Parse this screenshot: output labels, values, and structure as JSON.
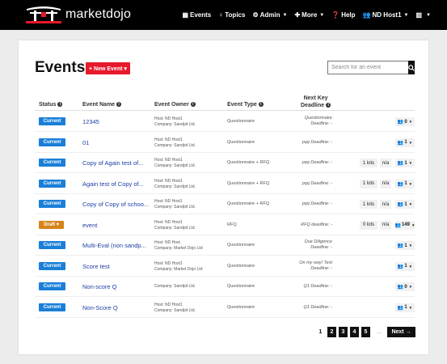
{
  "brand": {
    "name": "marketdojo"
  },
  "nav": [
    {
      "key": "events",
      "label": "Events",
      "icon": "calendar-icon",
      "glyph": "▦",
      "caret": false
    },
    {
      "key": "topics",
      "label": "Topics",
      "icon": "lightbulb-icon",
      "glyph": "♀",
      "caret": false
    },
    {
      "key": "admin",
      "label": "Admin",
      "icon": "cogs-icon",
      "glyph": "⚙",
      "caret": true
    },
    {
      "key": "more",
      "label": "More",
      "icon": "plus-icon",
      "glyph": "✚",
      "caret": true
    },
    {
      "key": "help",
      "label": "Help",
      "icon": "question-icon",
      "glyph": "❓",
      "caret": false
    },
    {
      "key": "user",
      "label": "ND Host1",
      "icon": "users-icon",
      "glyph": "👥",
      "caret": true
    },
    {
      "key": "lang",
      "label": "",
      "icon": "uk-flag-icon",
      "glyph": "▥",
      "caret": true
    }
  ],
  "page": {
    "title": "Events",
    "new_event_label": "+ New Event ▾",
    "search_placeholder": "Search for an event"
  },
  "columns": {
    "status": "Status",
    "name": "Event Name",
    "owner": "Event Owner",
    "type": "Event Type",
    "deadline_line1": "Next Key",
    "deadline_line2": "Deadline"
  },
  "rows": [
    {
      "status": "Current",
      "status_kind": "current",
      "name": "12345",
      "owner": [
        "Host: ND Host1",
        "Company: Sandpit Ltd."
      ],
      "type": "Questionnaire",
      "deadline": [
        "Questionnaire",
        "Deadline: -"
      ],
      "lots": "",
      "na": "",
      "users": "0"
    },
    {
      "status": "Current",
      "status_kind": "current",
      "name": "01",
      "owner": [
        "Host: ND Host1",
        "Company: Sandpit Ltd."
      ],
      "type": "Questionnaire",
      "deadline": [
        "pqq Deadline: -"
      ],
      "lots": "",
      "na": "",
      "users": "1"
    },
    {
      "status": "Current",
      "status_kind": "current",
      "name": "Copy of Again test of...",
      "owner": [
        "Host: ND Host1",
        "Company: Sandpit Ltd."
      ],
      "type": "Questionnaire + RFQ",
      "deadline": [
        "pqq Deadline: -"
      ],
      "lots": "1 lots",
      "na": "n/a",
      "users": "1"
    },
    {
      "status": "Current",
      "status_kind": "current",
      "name": "Again test of Copy of...",
      "owner": [
        "Host: ND Host1",
        "Company: Sandpit Ltd."
      ],
      "type": "Questionnaire + RFQ",
      "deadline": [
        "pqq Deadline: -"
      ],
      "lots": "1 lots",
      "na": "n/a",
      "users": "1"
    },
    {
      "status": "Current",
      "status_kind": "current",
      "name": "Copy of Copy of schoo...",
      "owner": [
        "Host: ND Host1",
        "Company: Sandpit Ltd."
      ],
      "type": "Questionnaire + RFQ",
      "deadline": [
        "pqq Deadline: -"
      ],
      "lots": "1 lots",
      "na": "n/a",
      "users": "1"
    },
    {
      "status": "Draft ▾",
      "status_kind": "draft",
      "name": "event",
      "owner": [
        "Host: ND Host1",
        "Company: Sandpit Ltd."
      ],
      "type": "RFQ",
      "deadline": [
        "RFQ deadline: -"
      ],
      "lots": "0 lots",
      "na": "n/a",
      "users": "149"
    },
    {
      "status": "Current",
      "status_kind": "current",
      "name": "Multi-Eval (non sandp...",
      "owner": [
        "Host: ND Host",
        "Company: Market Dojo Ltd"
      ],
      "type": "Questionnaire",
      "deadline": [
        "Due Diligence",
        "Deadline: -"
      ],
      "lots": "",
      "na": "",
      "users": "1"
    },
    {
      "status": "Current",
      "status_kind": "current",
      "name": "Score test",
      "owner": [
        "Host: ND Host1",
        "Company: Market Dojo Ltd"
      ],
      "type": "Questionnaire",
      "deadline": [
        "On my way! Test",
        "Deadline: -"
      ],
      "lots": "",
      "na": "",
      "users": "1"
    },
    {
      "status": "Current",
      "status_kind": "current",
      "name": "Non-score Q",
      "owner": [
        "Company: Sandpit Ltd."
      ],
      "type": "Questionnaire",
      "deadline": [
        "Q1 Deadline: -"
      ],
      "lots": "",
      "na": "",
      "users": "0"
    },
    {
      "status": "Current",
      "status_kind": "current",
      "name": "Non-Score Q",
      "owner": [
        "Host: ND Host1",
        "Company: Sandpit Ltd."
      ],
      "type": "Questionnaire",
      "deadline": [
        "Q1 Deadline: -"
      ],
      "lots": "",
      "na": "",
      "users": "1"
    }
  ],
  "pagination": {
    "pages": [
      "1",
      "2",
      "3",
      "4",
      "5"
    ],
    "current": "1",
    "ellipsis": "...",
    "next_label": "Next →"
  }
}
